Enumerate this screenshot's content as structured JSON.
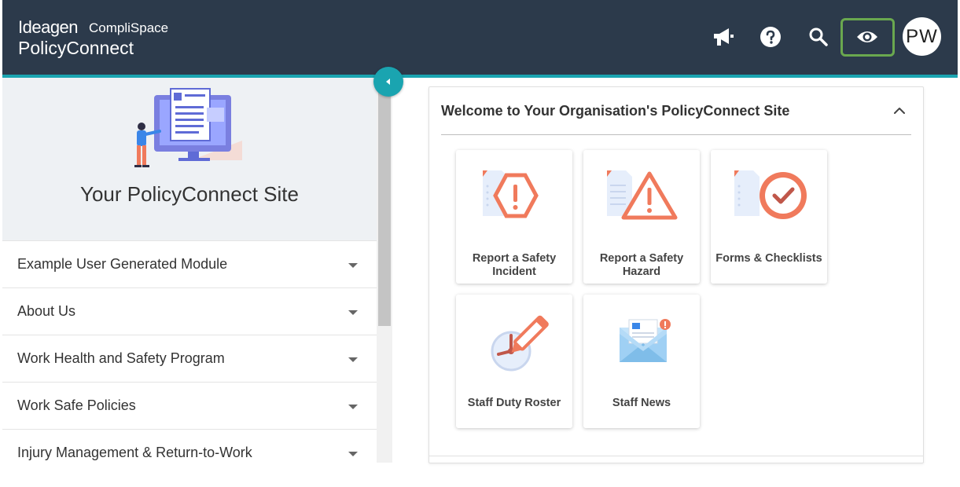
{
  "header": {
    "logo_brand": "Ideagen",
    "logo_product": "CompliSpace",
    "logo_app": "PolicyConnect",
    "icons": [
      "megaphone-icon",
      "help-icon",
      "search-icon",
      "eye-icon"
    ],
    "avatar_initials": "PW",
    "highlight_color": "#6aa84f"
  },
  "sidebar": {
    "hero_title": "Your PolicyConnect Site",
    "items": [
      {
        "label": "Example User Generated Module"
      },
      {
        "label": "About Us"
      },
      {
        "label": "Work Health and Safety Program"
      },
      {
        "label": "Work Safe Policies"
      },
      {
        "label": "Injury Management & Return-to-Work"
      }
    ]
  },
  "main": {
    "card_title": "Welcome to Your Organisation's PolicyConnect Site",
    "tiles": [
      {
        "label": "Report a Safety Incident",
        "icon": "safety-incident-icon"
      },
      {
        "label": "Report a Safety Hazard",
        "icon": "safety-hazard-icon"
      },
      {
        "label": "Forms & Checklists",
        "icon": "forms-checklists-icon"
      },
      {
        "label": "Staff Duty Roster",
        "icon": "duty-roster-icon"
      },
      {
        "label": "Staff News",
        "icon": "staff-news-icon"
      }
    ]
  },
  "colors": {
    "header_bg": "#2c3a4b",
    "accent": "#1aa4b0",
    "orange": "#f07a5c"
  }
}
